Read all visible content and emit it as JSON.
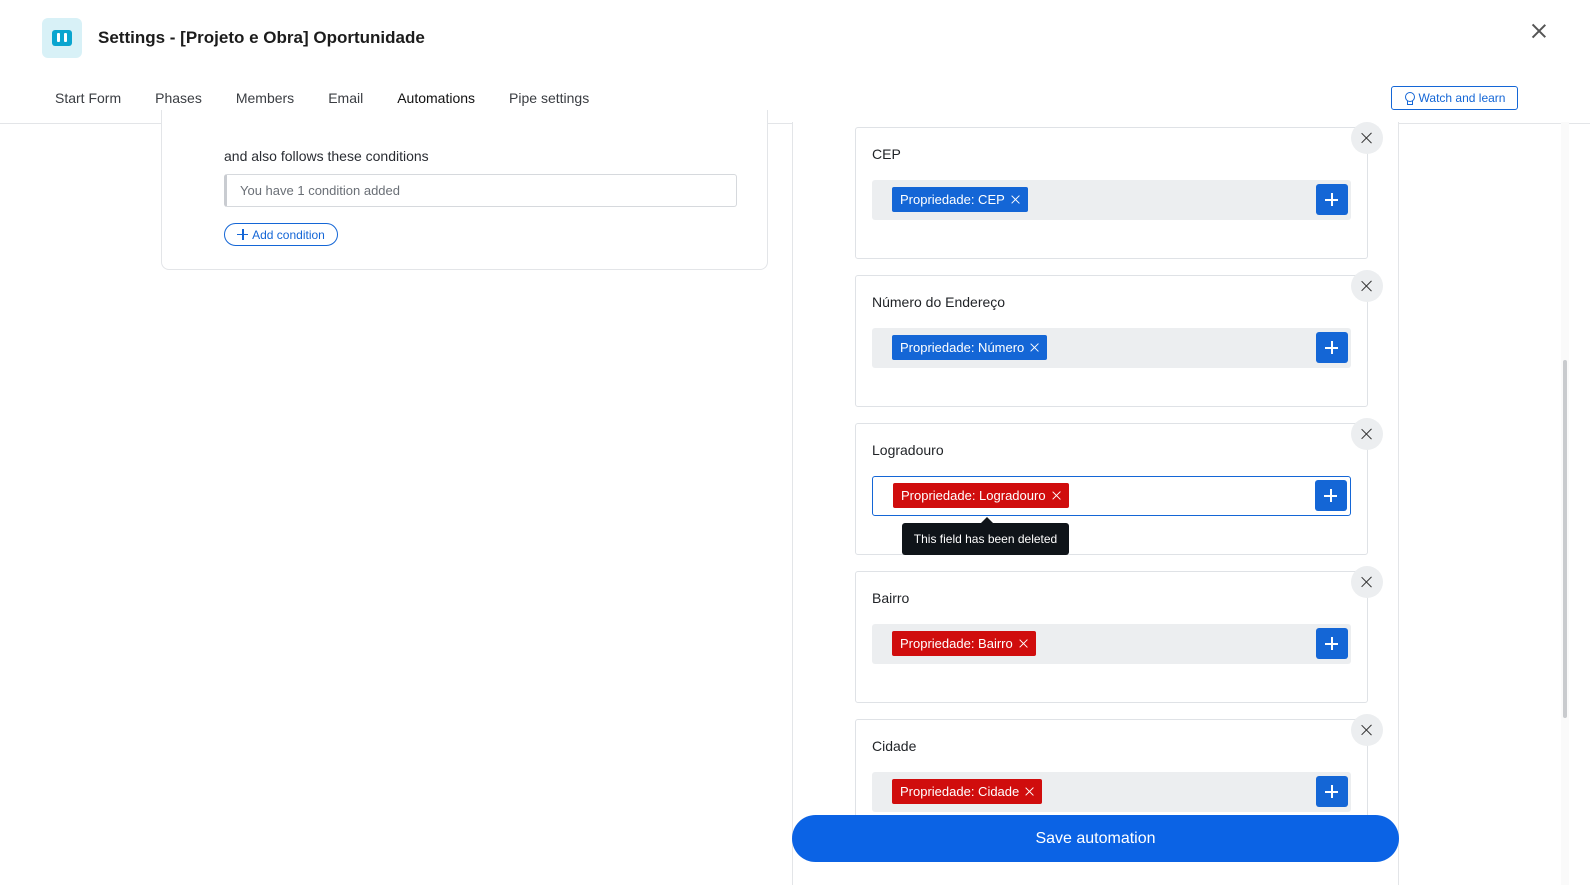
{
  "header": {
    "title": "Settings - [Projeto e Obra] Oportunidade",
    "app_icon": "kanban-icon",
    "watch_label": "Watch and learn",
    "tabs": [
      {
        "label": "Start Form",
        "active": false
      },
      {
        "label": "Phases",
        "active": false
      },
      {
        "label": "Members",
        "active": false
      },
      {
        "label": "Email",
        "active": false
      },
      {
        "label": "Automations",
        "active": true
      },
      {
        "label": "Pipe settings",
        "active": false
      }
    ]
  },
  "conditions": {
    "label": "and also follows these conditions",
    "summary": "You have 1 condition added",
    "add_label": "Add condition"
  },
  "fields": [
    {
      "label": "CEP",
      "chip": "Propriedade: CEP",
      "status": "ok"
    },
    {
      "label": "Número do Endereço",
      "chip": "Propriedade: Número",
      "status": "ok"
    },
    {
      "label": "Logradouro",
      "chip": "Propriedade: Logradouro",
      "status": "deleted"
    },
    {
      "label": "Bairro",
      "chip": "Propriedade: Bairro",
      "status": "deleted"
    },
    {
      "label": "Cidade",
      "chip": "Propriedade: Cidade",
      "status": "deleted"
    }
  ],
  "tooltip": "This field has been deleted",
  "save_label": "Save automation",
  "colors": {
    "accent": "#1466d6",
    "deleted": "#d00d0d",
    "save": "#0b63e5"
  }
}
